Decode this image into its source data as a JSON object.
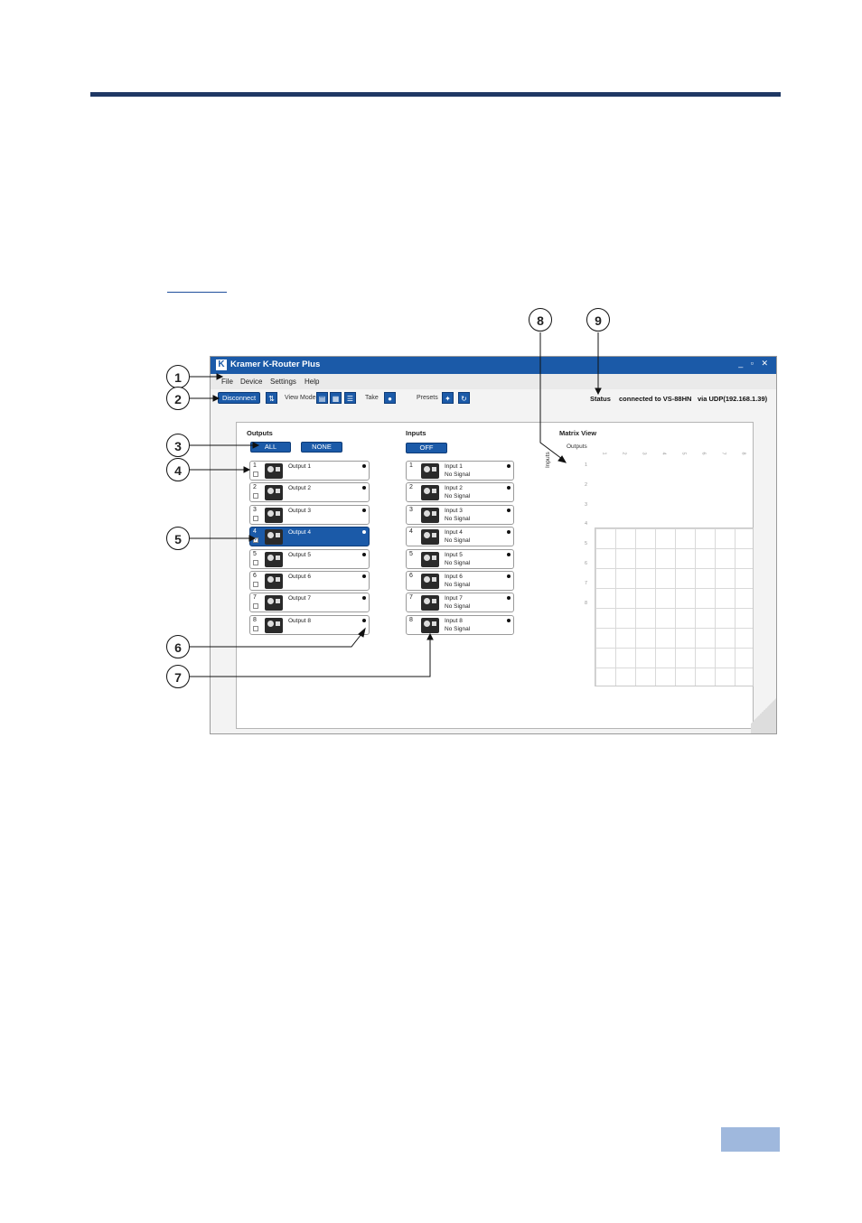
{
  "app": {
    "title": "Kramer K-Router Plus",
    "window_controls": "_ ▫ ✕",
    "menu": [
      "File",
      "Device",
      "Settings",
      "Help"
    ]
  },
  "toolbar": {
    "disconnect_label": "Disconnect",
    "view_mode_label": "View Mode",
    "take_label": "Take",
    "presets_label": "Presets",
    "status_label": "Status",
    "status_text": "connected to VS-88HN",
    "via_text": "via UDP(192.168.1.39)"
  },
  "outputs": {
    "title": "Outputs",
    "all_label": "ALL",
    "none_label": "NONE",
    "items": [
      {
        "num": "1",
        "name": "Output 1",
        "checked": false
      },
      {
        "num": "2",
        "name": "Output 2",
        "checked": false
      },
      {
        "num": "3",
        "name": "Output 3",
        "checked": false
      },
      {
        "num": "4",
        "name": "Output 4",
        "checked": true
      },
      {
        "num": "5",
        "name": "Output 5",
        "checked": false
      },
      {
        "num": "6",
        "name": "Output 6",
        "checked": false
      },
      {
        "num": "7",
        "name": "Output 7",
        "checked": false
      },
      {
        "num": "8",
        "name": "Output 8",
        "checked": false
      }
    ]
  },
  "inputs": {
    "title": "Inputs",
    "off_label": "OFF",
    "items": [
      {
        "num": "1",
        "name": "Input 1",
        "signal": "No Signal"
      },
      {
        "num": "2",
        "name": "Input 2",
        "signal": "No Signal"
      },
      {
        "num": "3",
        "name": "Input 3",
        "signal": "No Signal"
      },
      {
        "num": "4",
        "name": "Input 4",
        "signal": "No Signal"
      },
      {
        "num": "5",
        "name": "Input 5",
        "signal": "No Signal"
      },
      {
        "num": "6",
        "name": "Input 6",
        "signal": "No Signal"
      },
      {
        "num": "7",
        "name": "Input 7",
        "signal": "No Signal"
      },
      {
        "num": "8",
        "name": "Input 8",
        "signal": "No Signal"
      }
    ]
  },
  "matrix": {
    "title": "Matrix View",
    "outputs_label": "Outputs",
    "inputs_label": "Inputs",
    "col_labels": [
      "1",
      "2",
      "3",
      "4",
      "5",
      "6",
      "7",
      "8"
    ],
    "row_labels": [
      "1",
      "2",
      "3",
      "4",
      "5",
      "6",
      "7",
      "8"
    ]
  },
  "callouts": [
    "1",
    "2",
    "3",
    "4",
    "5",
    "6",
    "7",
    "8",
    "9"
  ],
  "colors": {
    "accent": "#1b5aa8",
    "page_bar": "#1f3864",
    "page_box": "#9fb8dd"
  }
}
